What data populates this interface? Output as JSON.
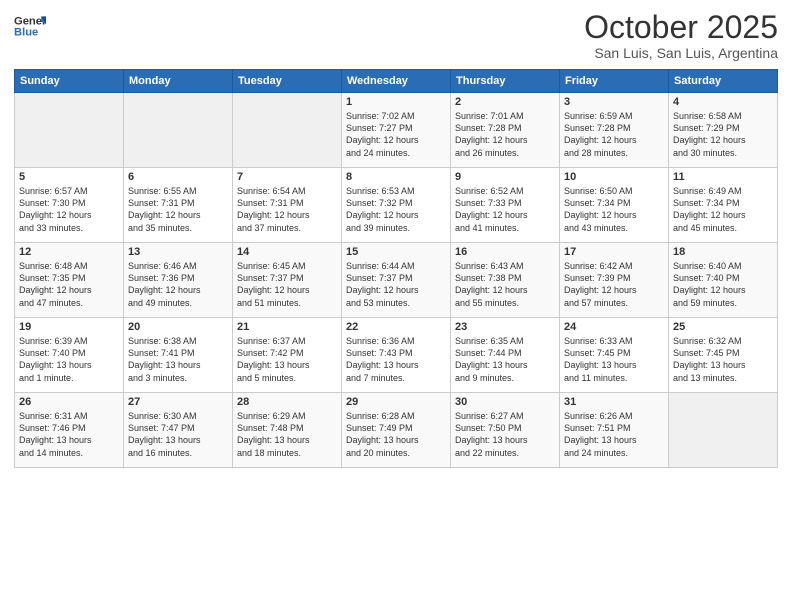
{
  "header": {
    "logo_line1": "General",
    "logo_line2": "Blue",
    "month": "October 2025",
    "location": "San Luis, San Luis, Argentina"
  },
  "weekdays": [
    "Sunday",
    "Monday",
    "Tuesday",
    "Wednesday",
    "Thursday",
    "Friday",
    "Saturday"
  ],
  "weeks": [
    [
      {
        "day": "",
        "info": ""
      },
      {
        "day": "",
        "info": ""
      },
      {
        "day": "",
        "info": ""
      },
      {
        "day": "1",
        "info": "Sunrise: 7:02 AM\nSunset: 7:27 PM\nDaylight: 12 hours\nand 24 minutes."
      },
      {
        "day": "2",
        "info": "Sunrise: 7:01 AM\nSunset: 7:28 PM\nDaylight: 12 hours\nand 26 minutes."
      },
      {
        "day": "3",
        "info": "Sunrise: 6:59 AM\nSunset: 7:28 PM\nDaylight: 12 hours\nand 28 minutes."
      },
      {
        "day": "4",
        "info": "Sunrise: 6:58 AM\nSunset: 7:29 PM\nDaylight: 12 hours\nand 30 minutes."
      }
    ],
    [
      {
        "day": "5",
        "info": "Sunrise: 6:57 AM\nSunset: 7:30 PM\nDaylight: 12 hours\nand 33 minutes."
      },
      {
        "day": "6",
        "info": "Sunrise: 6:55 AM\nSunset: 7:31 PM\nDaylight: 12 hours\nand 35 minutes."
      },
      {
        "day": "7",
        "info": "Sunrise: 6:54 AM\nSunset: 7:31 PM\nDaylight: 12 hours\nand 37 minutes."
      },
      {
        "day": "8",
        "info": "Sunrise: 6:53 AM\nSunset: 7:32 PM\nDaylight: 12 hours\nand 39 minutes."
      },
      {
        "day": "9",
        "info": "Sunrise: 6:52 AM\nSunset: 7:33 PM\nDaylight: 12 hours\nand 41 minutes."
      },
      {
        "day": "10",
        "info": "Sunrise: 6:50 AM\nSunset: 7:34 PM\nDaylight: 12 hours\nand 43 minutes."
      },
      {
        "day": "11",
        "info": "Sunrise: 6:49 AM\nSunset: 7:34 PM\nDaylight: 12 hours\nand 45 minutes."
      }
    ],
    [
      {
        "day": "12",
        "info": "Sunrise: 6:48 AM\nSunset: 7:35 PM\nDaylight: 12 hours\nand 47 minutes."
      },
      {
        "day": "13",
        "info": "Sunrise: 6:46 AM\nSunset: 7:36 PM\nDaylight: 12 hours\nand 49 minutes."
      },
      {
        "day": "14",
        "info": "Sunrise: 6:45 AM\nSunset: 7:37 PM\nDaylight: 12 hours\nand 51 minutes."
      },
      {
        "day": "15",
        "info": "Sunrise: 6:44 AM\nSunset: 7:37 PM\nDaylight: 12 hours\nand 53 minutes."
      },
      {
        "day": "16",
        "info": "Sunrise: 6:43 AM\nSunset: 7:38 PM\nDaylight: 12 hours\nand 55 minutes."
      },
      {
        "day": "17",
        "info": "Sunrise: 6:42 AM\nSunset: 7:39 PM\nDaylight: 12 hours\nand 57 minutes."
      },
      {
        "day": "18",
        "info": "Sunrise: 6:40 AM\nSunset: 7:40 PM\nDaylight: 12 hours\nand 59 minutes."
      }
    ],
    [
      {
        "day": "19",
        "info": "Sunrise: 6:39 AM\nSunset: 7:40 PM\nDaylight: 13 hours\nand 1 minute."
      },
      {
        "day": "20",
        "info": "Sunrise: 6:38 AM\nSunset: 7:41 PM\nDaylight: 13 hours\nand 3 minutes."
      },
      {
        "day": "21",
        "info": "Sunrise: 6:37 AM\nSunset: 7:42 PM\nDaylight: 13 hours\nand 5 minutes."
      },
      {
        "day": "22",
        "info": "Sunrise: 6:36 AM\nSunset: 7:43 PM\nDaylight: 13 hours\nand 7 minutes."
      },
      {
        "day": "23",
        "info": "Sunrise: 6:35 AM\nSunset: 7:44 PM\nDaylight: 13 hours\nand 9 minutes."
      },
      {
        "day": "24",
        "info": "Sunrise: 6:33 AM\nSunset: 7:45 PM\nDaylight: 13 hours\nand 11 minutes."
      },
      {
        "day": "25",
        "info": "Sunrise: 6:32 AM\nSunset: 7:45 PM\nDaylight: 13 hours\nand 13 minutes."
      }
    ],
    [
      {
        "day": "26",
        "info": "Sunrise: 6:31 AM\nSunset: 7:46 PM\nDaylight: 13 hours\nand 14 minutes."
      },
      {
        "day": "27",
        "info": "Sunrise: 6:30 AM\nSunset: 7:47 PM\nDaylight: 13 hours\nand 16 minutes."
      },
      {
        "day": "28",
        "info": "Sunrise: 6:29 AM\nSunset: 7:48 PM\nDaylight: 13 hours\nand 18 minutes."
      },
      {
        "day": "29",
        "info": "Sunrise: 6:28 AM\nSunset: 7:49 PM\nDaylight: 13 hours\nand 20 minutes."
      },
      {
        "day": "30",
        "info": "Sunrise: 6:27 AM\nSunset: 7:50 PM\nDaylight: 13 hours\nand 22 minutes."
      },
      {
        "day": "31",
        "info": "Sunrise: 6:26 AM\nSunset: 7:51 PM\nDaylight: 13 hours\nand 24 minutes."
      },
      {
        "day": "",
        "info": ""
      }
    ]
  ]
}
